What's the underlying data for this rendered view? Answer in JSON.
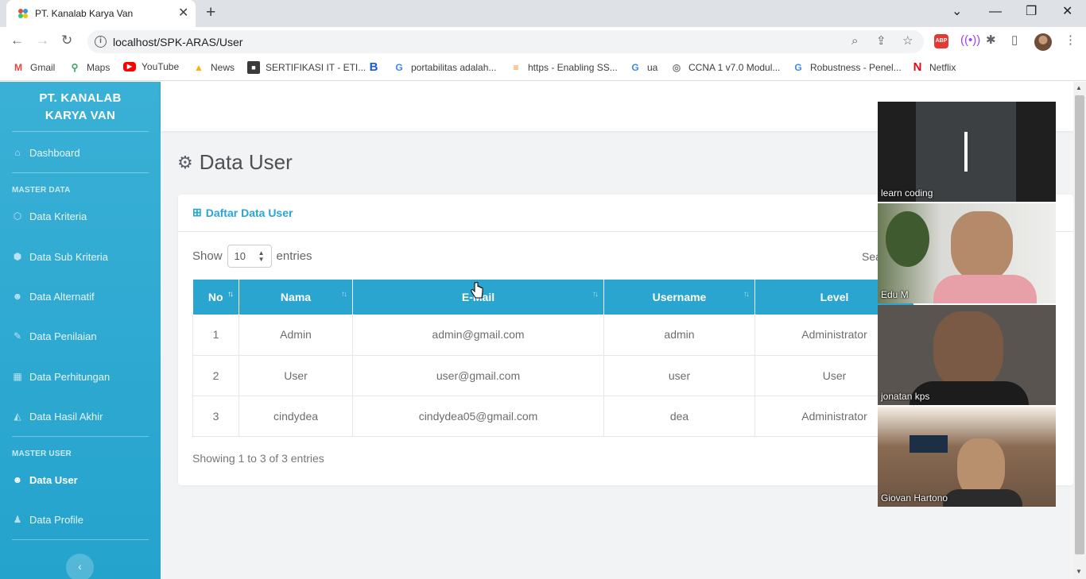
{
  "browser": {
    "tab_title": "PT. Kanalab Karya Van",
    "url": "localhost/SPK-ARAS/User",
    "bookmarks": [
      {
        "label": "Gmail",
        "icon": "gmail-icon",
        "color": "#ea4335",
        "glyph": "M"
      },
      {
        "label": "Maps",
        "icon": "maps-icon",
        "color": "#34a853",
        "glyph": "⬤"
      },
      {
        "label": "YouTube",
        "icon": "youtube-icon",
        "color": "#ff0000",
        "glyph": "▶"
      },
      {
        "label": "News",
        "icon": "news-icon",
        "color": "#f4b400",
        "glyph": "▲"
      },
      {
        "label": "SERTIFIKASI IT - ETI...",
        "icon": "sertifikasi-icon",
        "color": "#4a4a4a",
        "glyph": "■"
      },
      {
        "label": "",
        "icon": "bold-b-icon",
        "color": "#1a56db",
        "glyph": "B"
      },
      {
        "label": "portabilitas adalah...",
        "icon": "google-icon",
        "color": "#4285f4",
        "glyph": "G"
      },
      {
        "label": "https - Enabling SS...",
        "icon": "stackoverflow-icon",
        "color": "#f48024",
        "glyph": "≡"
      },
      {
        "label": "ua",
        "icon": "google-icon",
        "color": "#4285f4",
        "glyph": "G"
      },
      {
        "label": "CCNA 1 v7.0 Modul...",
        "icon": "ccna-icon",
        "color": "#777777",
        "glyph": "◎"
      },
      {
        "label": "Robustness - Penel...",
        "icon": "google-icon",
        "color": "#4285f4",
        "glyph": "G"
      },
      {
        "label": "Netflix",
        "icon": "netflix-icon",
        "color": "#e50914",
        "glyph": "N"
      }
    ]
  },
  "sidebar": {
    "brand_line1": "PT. KANALAB",
    "brand_line2": "KARYA VAN",
    "dashboard": "Dashboard",
    "heading_master_data": "MASTER DATA",
    "items_master_data": [
      "Data Kriteria",
      "Data Sub Kriteria",
      "Data Alternatif",
      "Data Penilaian",
      "Data Perhitungan",
      "Data Hasil Akhir"
    ],
    "heading_master_user": "MASTER USER",
    "items_master_user": [
      "Data User",
      "Data Profile"
    ],
    "active_item": "Data User"
  },
  "main": {
    "page_title": "Data User",
    "card_title": "Daftar Data User",
    "show_label": "Show",
    "entries_value": "10",
    "entries_label": "entries",
    "search_label": "Sea",
    "columns": [
      "No",
      "Nama",
      "E-Mail",
      "Username",
      "Level"
    ],
    "rows": [
      [
        "1",
        "Admin",
        "admin@gmail.com",
        "admin",
        "Administrator"
      ],
      [
        "2",
        "User",
        "user@gmail.com",
        "user",
        "User"
      ],
      [
        "3",
        "cindydea",
        "cindydea05@gmail.com",
        "dea",
        "Administrator"
      ]
    ],
    "info_text": "Showing 1 to 3 of 3 entries"
  },
  "video_call": {
    "participants": [
      "learn coding",
      "Edu M",
      "jonatan kps",
      "Giovan Hartono"
    ]
  },
  "colors": {
    "sidebar": "#2aa5cf",
    "accent": "#2aa5cf"
  }
}
